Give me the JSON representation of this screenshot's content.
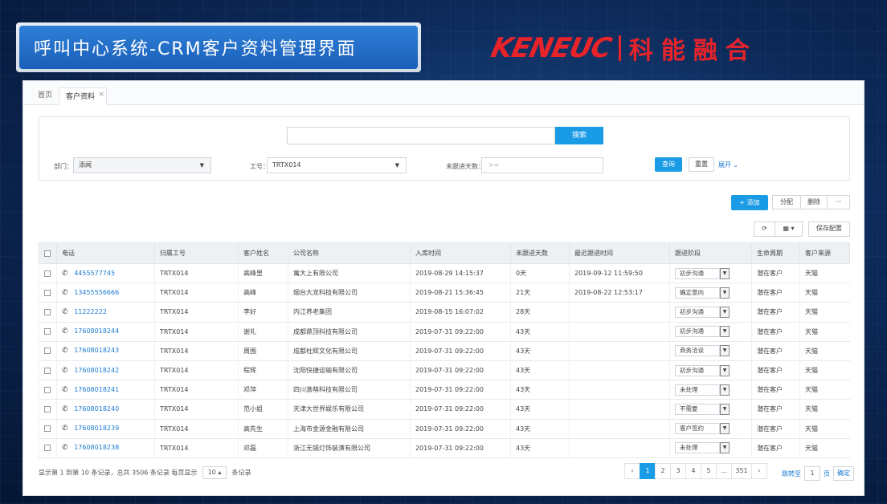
{
  "banner": {
    "title": "呼叫中心系统-CRM客户资料管理界面"
  },
  "logo": {
    "en": "KENEUC",
    "cn": "科能融合"
  },
  "tabs": [
    {
      "label": "首页"
    },
    {
      "label": "客户资料",
      "close": "×"
    }
  ],
  "search": {
    "button": "搜索",
    "value": ""
  },
  "filters": {
    "dept_label": "部门：",
    "dept_value": "添闻",
    "job_label": "工号：",
    "job_value": "TRTX014",
    "days_label": "未跟进天数：",
    "days_placeholder": ">=",
    "query": "查询",
    "reset": "重置",
    "expand": "展开"
  },
  "toolbar": {
    "add": "+ 添加",
    "assign": "分配",
    "delete": "删除",
    "more": "···",
    "save_config": "保存配置"
  },
  "icons": {
    "refresh": "⟳",
    "columns": "▦ ▾",
    "phone": "✆",
    "caret": "▼"
  },
  "table": {
    "headers": [
      "电话",
      "归属工号",
      "客户姓名",
      "公司名称",
      "入库时间",
      "未跟进天数",
      "最近跟进时间",
      "跟进阶段",
      "生命周期",
      "客户来源"
    ],
    "rows": [
      {
        "phone": "4455577745",
        "job": "TRTX014",
        "name": "高峰里",
        "company": "寓大上有限公司",
        "in_time": "2019-08-29 14:15:37",
        "days": "0天",
        "last": "2019-09-12 11:59:50",
        "stage": "初步沟通",
        "life": "潜在客户",
        "source": "天猫"
      },
      {
        "phone": "13455556666",
        "job": "TRTX014",
        "name": "高峰",
        "company": "烟台大龙科技有限公司",
        "in_time": "2019-08-21 15:36:45",
        "days": "21天",
        "last": "2019-08-22 12:53:17",
        "stage": "确定意向",
        "life": "潜在客户",
        "source": "天猫"
      },
      {
        "phone": "11222222",
        "job": "TRTX014",
        "name": "李好",
        "company": "内江养老集团",
        "in_time": "2019-08-15 16:07:02",
        "days": "28天",
        "last": "",
        "stage": "初步沟通",
        "life": "潜在客户",
        "source": "天猫"
      },
      {
        "phone": "17608018244",
        "job": "TRTX014",
        "name": "谢礼",
        "company": "成都鼎顶科技有限公司",
        "in_time": "2019-07-31 09:22:00",
        "days": "43天",
        "last": "",
        "stage": "初步沟通",
        "life": "潜在客户",
        "source": "天猫"
      },
      {
        "phone": "17608018243",
        "job": "TRTX014",
        "name": "周围",
        "company": "成都杜辉文化有限公司",
        "in_time": "2019-07-31 09:22:00",
        "days": "43天",
        "last": "",
        "stage": "商务洽谈",
        "life": "潜在客户",
        "source": "天猫"
      },
      {
        "phone": "17608018242",
        "job": "TRTX014",
        "name": "程辉",
        "company": "沈阳快捷运输有限公司",
        "in_time": "2019-07-31 09:22:00",
        "days": "43天",
        "last": "",
        "stage": "初步沟通",
        "life": "潜在客户",
        "source": "天猫"
      },
      {
        "phone": "17608018241",
        "job": "TRTX014",
        "name": "邓萍",
        "company": "四川激萌科技有限公司",
        "in_time": "2019-07-31 09:22:00",
        "days": "43天",
        "last": "",
        "stage": "未处理",
        "life": "潜在客户",
        "source": "天猫"
      },
      {
        "phone": "17608018240",
        "job": "TRTX014",
        "name": "范小姐",
        "company": "天津大世界娱乐有限公司",
        "in_time": "2019-07-31 09:22:00",
        "days": "43天",
        "last": "",
        "stage": "不需要",
        "life": "潜在客户",
        "source": "天猫"
      },
      {
        "phone": "17608018239",
        "job": "TRTX014",
        "name": "高先生",
        "company": "上海市金源金融有限公司",
        "in_time": "2019-07-31 09:22:00",
        "days": "43天",
        "last": "",
        "stage": "客户签约",
        "life": "潜在客户",
        "source": "天猫"
      },
      {
        "phone": "17608018238",
        "job": "TRTX014",
        "name": "邓磊",
        "company": "浙江无锡灯饰装潢有限公司",
        "in_time": "2019-07-31 09:22:00",
        "days": "43天",
        "last": "",
        "stage": "未处理",
        "life": "潜在客户",
        "source": "天猫"
      }
    ]
  },
  "footer": {
    "info_prefix": "显示第 1 到第 10 条记录，总共 3506 条记录 每页显示",
    "page_size": "10 ▴",
    "info_suffix": "条记录",
    "pages": [
      "‹",
      "1",
      "2",
      "3",
      "4",
      "5",
      "...",
      "351",
      "›"
    ],
    "jump_label": "跳转至",
    "jump_value": "1",
    "jump_unit": "页",
    "jump_ok": "确定"
  }
}
